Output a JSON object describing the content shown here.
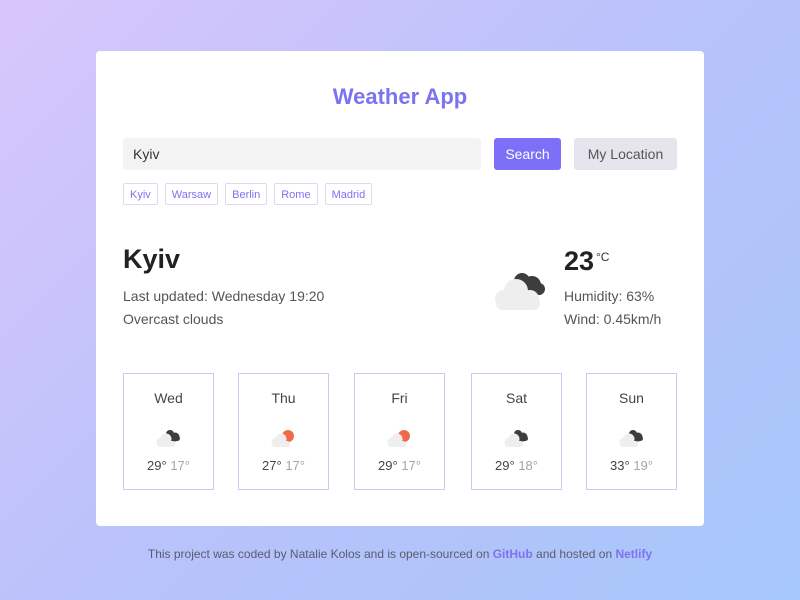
{
  "app": {
    "title": "Weather App"
  },
  "search": {
    "value": "Kyiv",
    "search_label": "Search",
    "location_label": "My Location",
    "quick_cities": [
      "Kyiv",
      "Warsaw",
      "Berlin",
      "Rome",
      "Madrid"
    ]
  },
  "current": {
    "city": "Kyiv",
    "updated": "Last updated: Wednesday 19:20",
    "description": "Overcast clouds",
    "temperature": "23",
    "unit": "°C",
    "humidity": "Humidity: 63%",
    "wind": "Wind: 0.45km/h",
    "icon": "overcast-clouds-icon"
  },
  "forecast": [
    {
      "day": "Wed",
      "max": "29°",
      "min": "17°",
      "icon": "dark-clouds-icon"
    },
    {
      "day": "Thu",
      "max": "27°",
      "min": "17°",
      "icon": "sun-behind-cloud-icon"
    },
    {
      "day": "Fri",
      "max": "29°",
      "min": "17°",
      "icon": "sun-behind-cloud-icon"
    },
    {
      "day": "Sat",
      "max": "29°",
      "min": "18°",
      "icon": "dark-clouds-icon"
    },
    {
      "day": "Sun",
      "max": "33°",
      "min": "19°",
      "icon": "dark-clouds-icon"
    }
  ],
  "footer": {
    "text_before": "This project was coded by Natalie Kolos and is open-sourced on ",
    "github_label": "GitHub",
    "text_middle": " and hosted on ",
    "netlify_label": "Netlify"
  },
  "colors": {
    "accent": "#7d72f0",
    "button": "#7c6ff8",
    "sun": "#f06a4a"
  }
}
